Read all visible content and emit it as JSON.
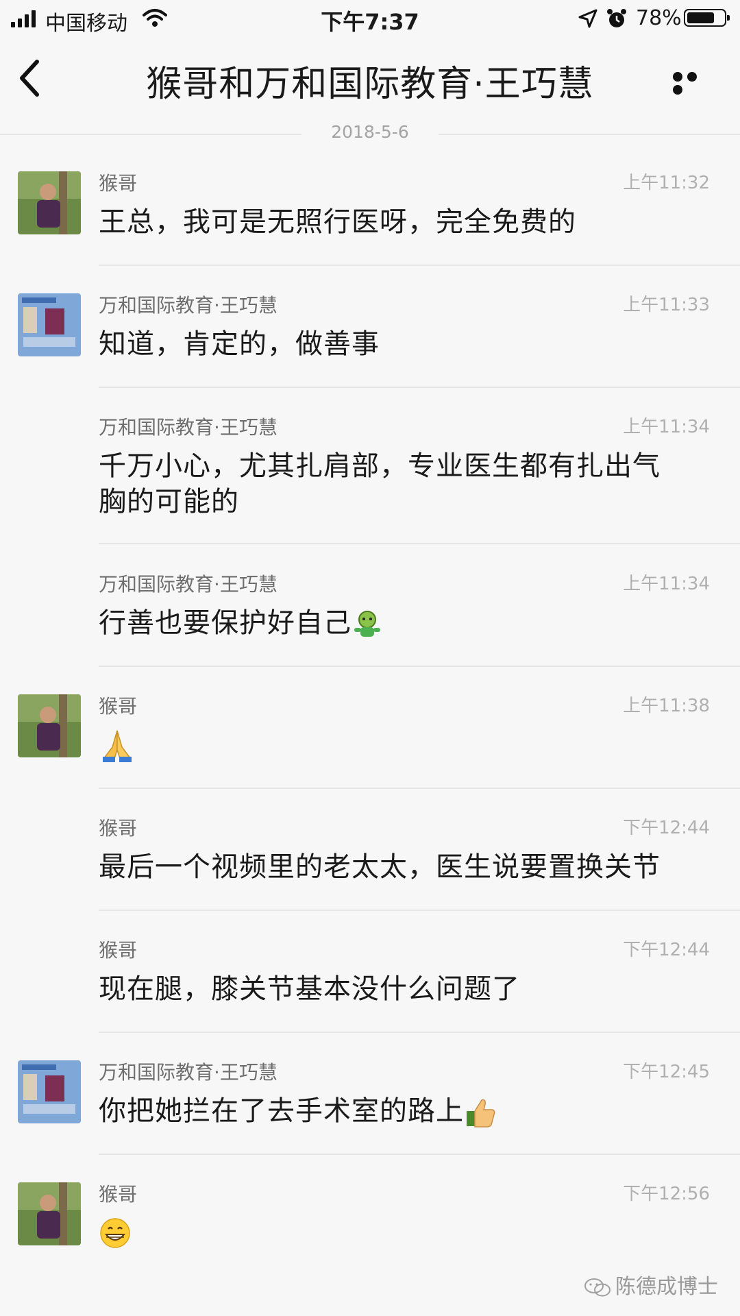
{
  "status_bar": {
    "carrier": "中国移动",
    "time": "下午7:37",
    "battery": "78%",
    "battery_level": 0.78
  },
  "nav": {
    "title": "猴哥和万和国际教育·王巧慧"
  },
  "date_divider": "2018-5-6",
  "messages": [
    {
      "sender": "猴哥",
      "time": "上午11:32",
      "text": "王总，我可是无照行医呀，完全免费的"
    },
    {
      "sender": "万和国际教育·王巧慧",
      "time": "上午11:33",
      "text": "知道，肯定的，做善事"
    },
    {
      "sender": "万和国际教育·王巧慧",
      "time": "上午11:34",
      "text": "千万小心，尤其扎肩部，专业医生都有扎出气胸的可能的"
    },
    {
      "sender": "万和国际教育·王巧慧",
      "time": "上午11:34",
      "text": "行善也要保护好自己",
      "emoji": "green-figure-emoji"
    },
    {
      "sender": "猴哥",
      "time": "上午11:38",
      "text": "",
      "emoji": "praying-hands-emoji"
    },
    {
      "sender": "猴哥",
      "time": "下午12:44",
      "text": "最后一个视频里的老太太，医生说要置换关节"
    },
    {
      "sender": "猴哥",
      "time": "下午12:44",
      "text": "现在腿，膝关节基本没什么问题了"
    },
    {
      "sender": "万和国际教育·王巧慧",
      "time": "下午12:45",
      "text": "你把她拦在了去手术室的路上",
      "emoji": "thumbs-up-emoji"
    },
    {
      "sender": "猴哥",
      "time": "下午12:56",
      "text": "",
      "emoji": "grinning-face-emoji"
    }
  ],
  "watermark": "陈德成博士"
}
